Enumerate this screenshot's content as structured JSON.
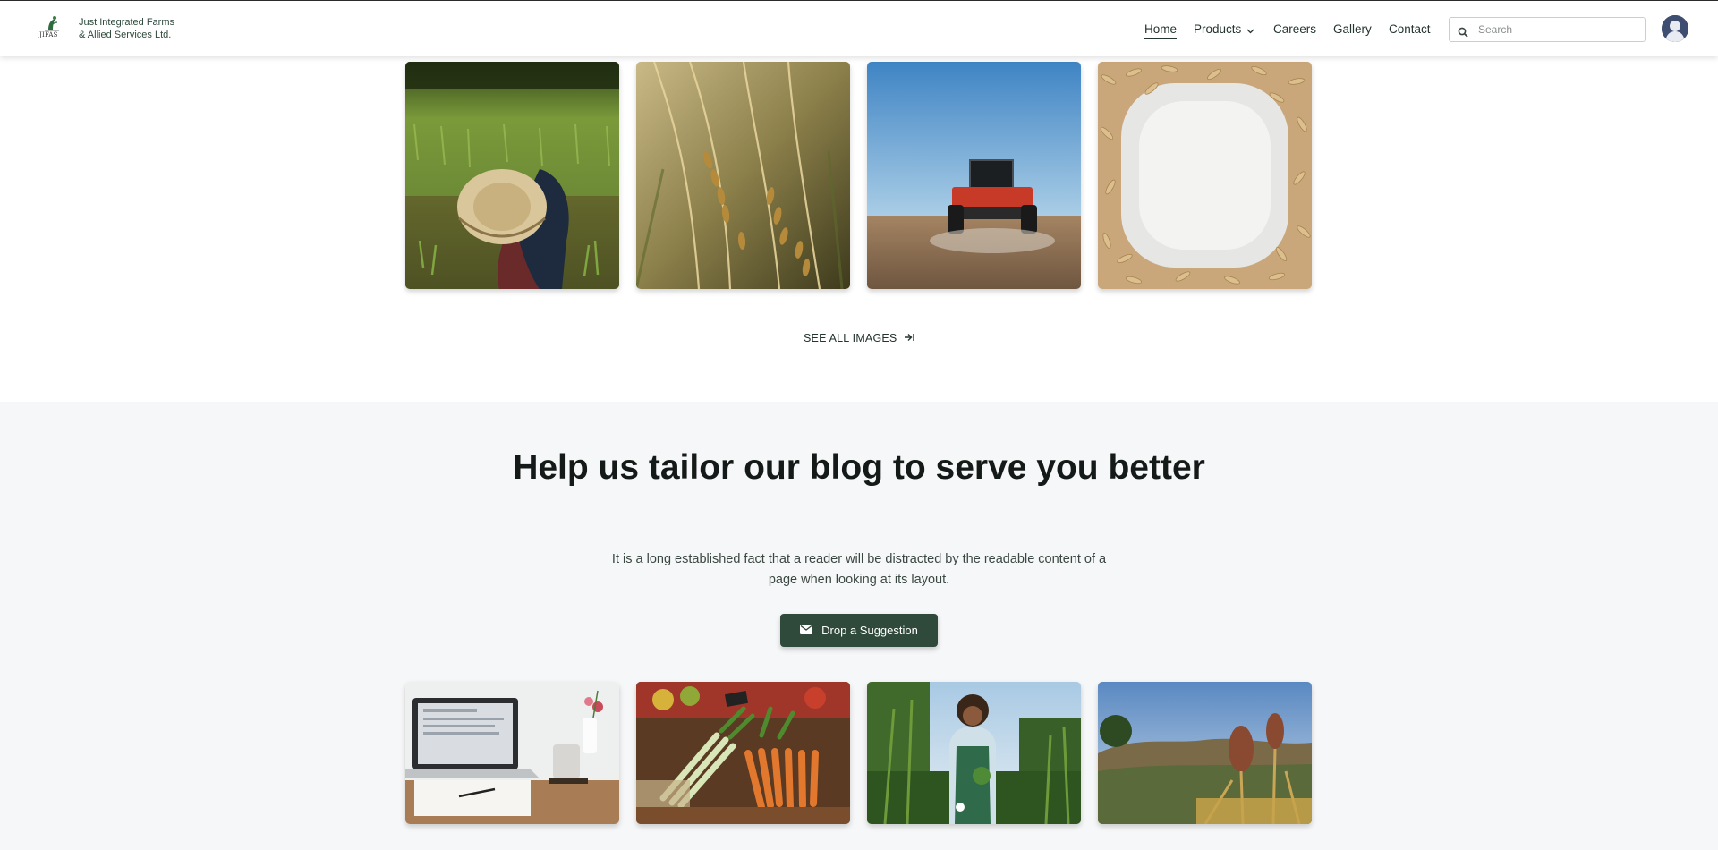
{
  "header": {
    "brand_abbrev": "JIFAS",
    "brand_line1": "Just Integrated Farms",
    "brand_line2": "& Allied Services Ltd.",
    "nav": {
      "home": "Home",
      "products": "Products",
      "careers": "Careers",
      "gallery": "Gallery",
      "contact": "Contact"
    },
    "search_placeholder": "Search"
  },
  "gallery": {
    "images": [
      {
        "name": "farmer-straw-hat-rice-field"
      },
      {
        "name": "rice-grain-stalks"
      },
      {
        "name": "red-tractor-spreading-field"
      },
      {
        "name": "rice-grains-frame"
      }
    ],
    "see_all_label": "SEE ALL IMAGES"
  },
  "blog": {
    "title": "Help us tailor our blog to serve you better",
    "description": "It is a long established fact that a reader will be distracted by the readable content of a page when looking at its layout.",
    "button_label": "Drop a Suggestion",
    "images": [
      {
        "name": "laptop-on-desk"
      },
      {
        "name": "vegetables-market-stall"
      },
      {
        "name": "smiling-farmer-holding-greens"
      },
      {
        "name": "sorghum-field-hills"
      }
    ]
  },
  "colors": {
    "brand_dark_green": "#2f4a3b",
    "text_dark": "#141a17",
    "section_bg": "#f6f7f8"
  }
}
